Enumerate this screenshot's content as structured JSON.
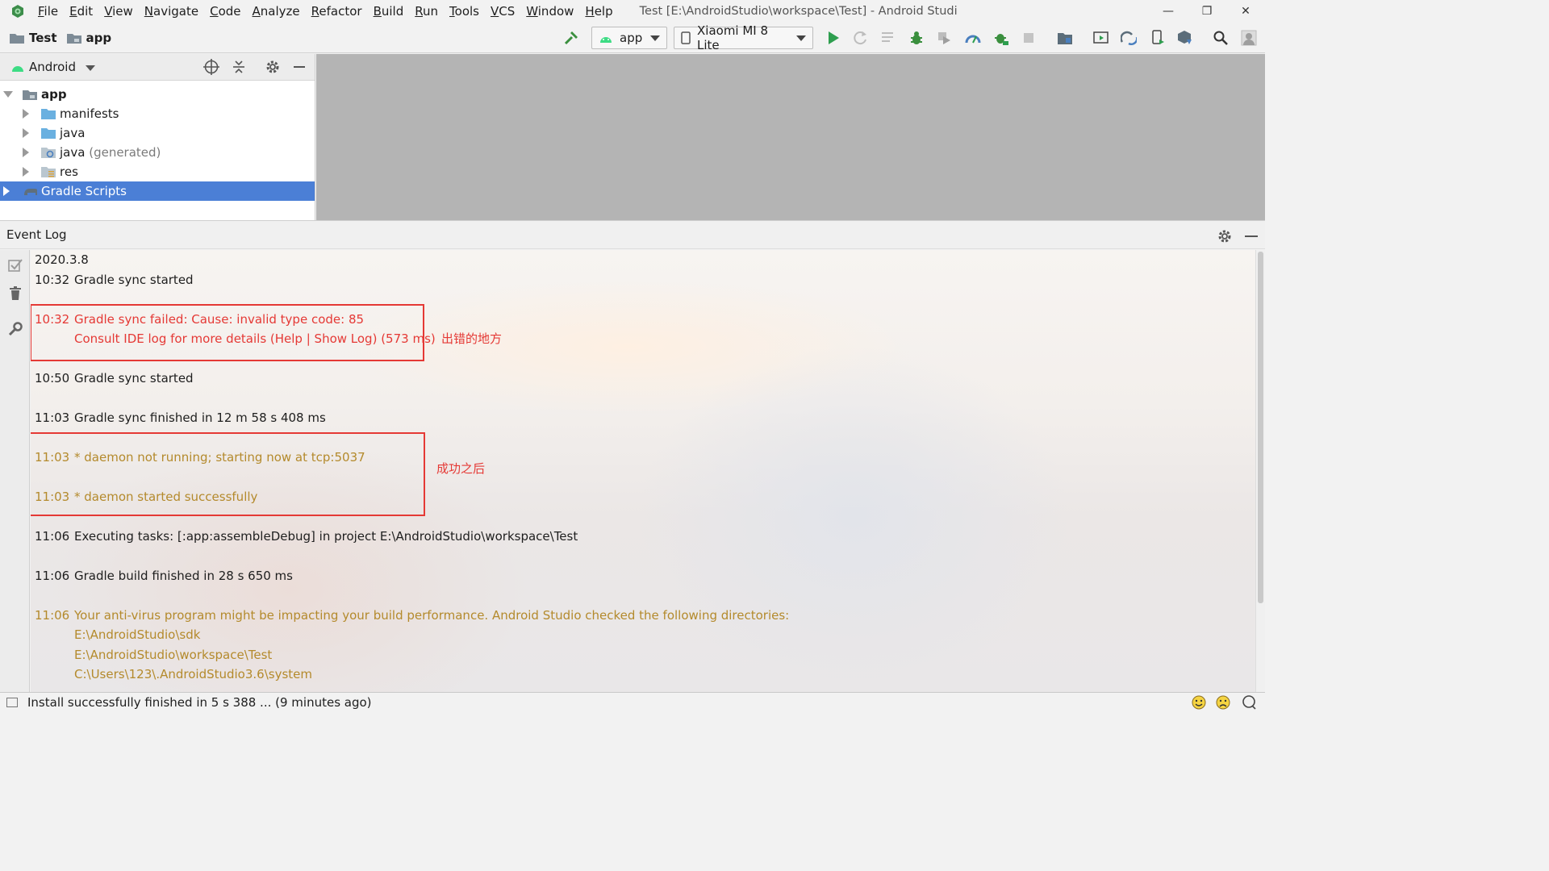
{
  "menubar": {
    "items": [
      "File",
      "Edit",
      "View",
      "Navigate",
      "Code",
      "Analyze",
      "Refactor",
      "Build",
      "Run",
      "Tools",
      "VCS",
      "Window",
      "Help"
    ],
    "window_title": "Test [E:\\AndroidStudio\\workspace\\Test] - Android Studi"
  },
  "window_controls": {
    "minimize": "—",
    "restore": "❐",
    "close": "✕"
  },
  "toolbar": {
    "breadcrumb": [
      "Test",
      "app"
    ],
    "config_selector": "app",
    "device_selector": "Xiaomi MI 8 Lite",
    "accent_run": "#2e9e4f",
    "accent_android": "#3ddc84"
  },
  "project_panel": {
    "view_mode": "Android",
    "tree": [
      {
        "label": "app",
        "bold": true,
        "expanded": true
      },
      {
        "label": "manifests"
      },
      {
        "label": "java"
      },
      {
        "label": "java",
        "suffix": "(generated)"
      },
      {
        "label": "res"
      },
      {
        "label": "Gradle Scripts",
        "selected": true
      }
    ]
  },
  "event_log": {
    "title": "Event Log",
    "date": "2020.3.8",
    "entries": [
      {
        "time": "10:32",
        "text": "Gradle sync started",
        "level": "info"
      },
      {
        "time": "10:32",
        "text": "Gradle sync failed: Cause: invalid type code: 85",
        "level": "error",
        "continuation": "Consult IDE log for more details (Help | Show Log) (573 ms)"
      },
      {
        "time": "10:50",
        "text": "Gradle sync started",
        "level": "info"
      },
      {
        "time": "11:03",
        "text": "Gradle sync finished in 12 m 58 s 408 ms",
        "level": "info"
      },
      {
        "time": "11:03",
        "text": "* daemon not running; starting now at tcp:5037",
        "level": "warning"
      },
      {
        "time": "11:03",
        "text": "* daemon started successfully",
        "level": "warning"
      },
      {
        "time": "11:06",
        "text": "Executing tasks: [:app:assembleDebug] in project E:\\AndroidStudio\\workspace\\Test",
        "level": "info"
      },
      {
        "time": "11:06",
        "text": "Gradle build finished in 28 s 650 ms",
        "level": "info"
      },
      {
        "time": "11:06",
        "text": "Your anti-virus program might be impacting your build performance. Android Studio checked the following directories:",
        "level": "warning",
        "continuation_lines": [
          "E:\\AndroidStudio\\sdk",
          "E:\\AndroidStudio\\workspace\\Test",
          "C:\\Users\\123\\.AndroidStudio3.6\\system"
        ]
      }
    ],
    "annotations": {
      "error_note": "出错的地方",
      "success_note": "成功之后"
    },
    "colors": {
      "error": "#e53935",
      "warning": "#b48a2c",
      "highlight_box": "#e53935"
    }
  },
  "status_bar": {
    "message": "Install successfully finished in 5 s 388 ... (9 minutes ago)"
  }
}
